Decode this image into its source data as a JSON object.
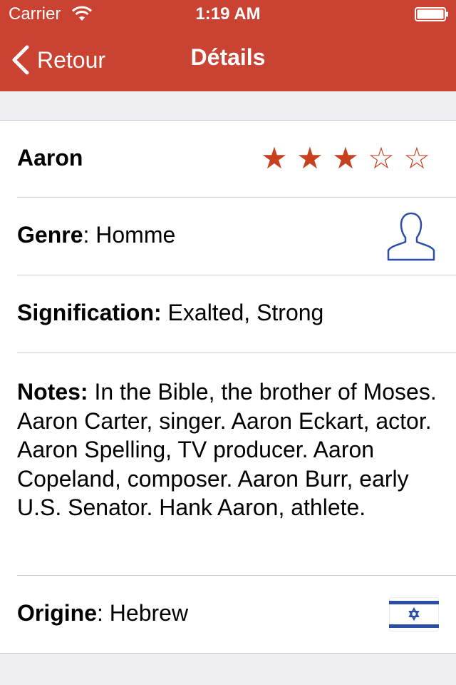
{
  "status_bar": {
    "carrier": "Carrier",
    "time": "1:19 AM"
  },
  "nav": {
    "back_label": "Retour",
    "title": "Détails"
  },
  "name_row": {
    "name": "Aaron",
    "rating": 3,
    "rating_max": 5
  },
  "genre_row": {
    "label": "Genre",
    "value": ": Homme",
    "icon": "person-icon"
  },
  "meaning_row": {
    "label": "Signification:",
    "value": " Exalted, Strong"
  },
  "notes_row": {
    "label": "Notes:",
    "value": " In the Bible, the brother of Moses.  Aaron Carter, singer. Aaron Eckart, actor. Aaron Spelling, TV producer. Aaron Copeland, composer. Aaron Burr, early U.S. Senator. Hank Aaron, athlete."
  },
  "origin_row": {
    "label": "Origine",
    "value": ": Hebrew",
    "icon": "israel-flag-icon"
  },
  "colors": {
    "nav_bar": "#c94232",
    "star": "#c8411f",
    "icon_blue": "#2c4ea6"
  }
}
